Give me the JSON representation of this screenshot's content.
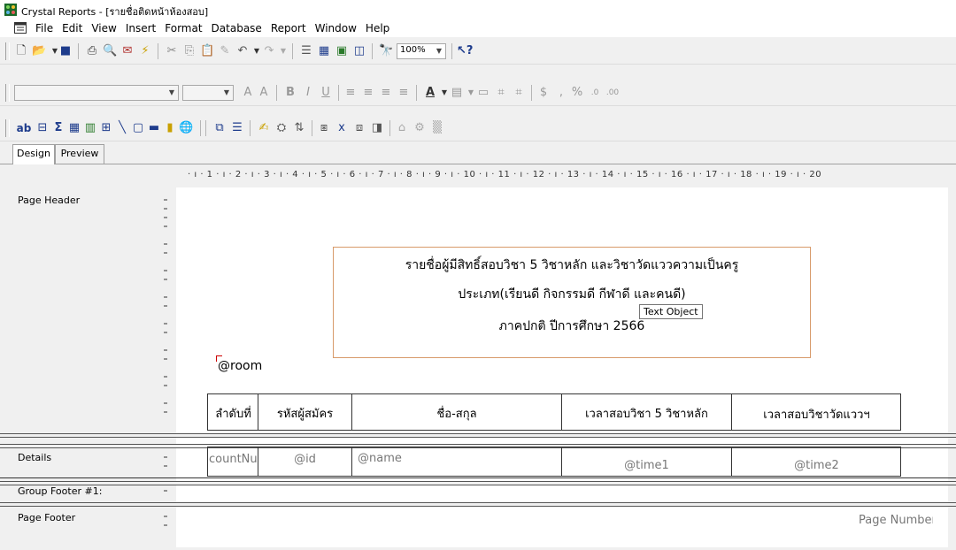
{
  "window": {
    "title": "Crystal Reports - [รายชื่อติดหน้าห้องสอบ]"
  },
  "menu": [
    "File",
    "Edit",
    "View",
    "Insert",
    "Format",
    "Database",
    "Report",
    "Window",
    "Help"
  ],
  "toolbar1": {
    "zoom": "100%"
  },
  "toolbar2": {
    "font_name": "",
    "font_size": "",
    "currency_symbol": "$",
    "comma_symbol": ",",
    "percent_symbol": "%"
  },
  "toolbar3": {
    "text_object_label": "ab",
    "sum_symbol": "Σ"
  },
  "tabs": [
    "Design",
    "Preview"
  ],
  "ruler": {
    "ticks": "· ı · 1 · ı · 2 · ı · 3 · ı · 4 · ı · 5 · ı · 6 · ı · 7 · ı · 8 · ı · 9 · ı · 10 · ı · 11 · ı · 12 · ı · 13 · ı · 14 · ı · 15 · ı · 16 · ı · 17 · ı · 18 · ı · 19 · ı · 20"
  },
  "sections": {
    "page_header": "Page Header",
    "details": "Details",
    "group_footer": "Group Footer #1:",
    "page_footer": "Page Footer"
  },
  "report": {
    "title_line1": "รายชื่อผู้มีสิทธิ์สอบวิชา 5 วิชาหลัก และวิชาวัดแววความเป็นครู",
    "title_line2": "ประเภท(เรียนดี กิจกรรมดี กีฬาดี และคนดี)",
    "title_line3": "ภาคปกติ ปีการศึกษา 2566",
    "tooltip": "Text Object",
    "room_field": "@room",
    "headers": [
      "ลำดับที่",
      "รหัสผู้สมัคร",
      "ชื่อ-สกุล",
      "เวลาสอบวิชา 5 วิชาหลัก",
      "เวลาสอบวิชาวัดแววฯ"
    ],
    "details": [
      "countNu",
      "@id",
      "@name",
      "@time1",
      "@time2"
    ],
    "page_number": "Page Number"
  }
}
